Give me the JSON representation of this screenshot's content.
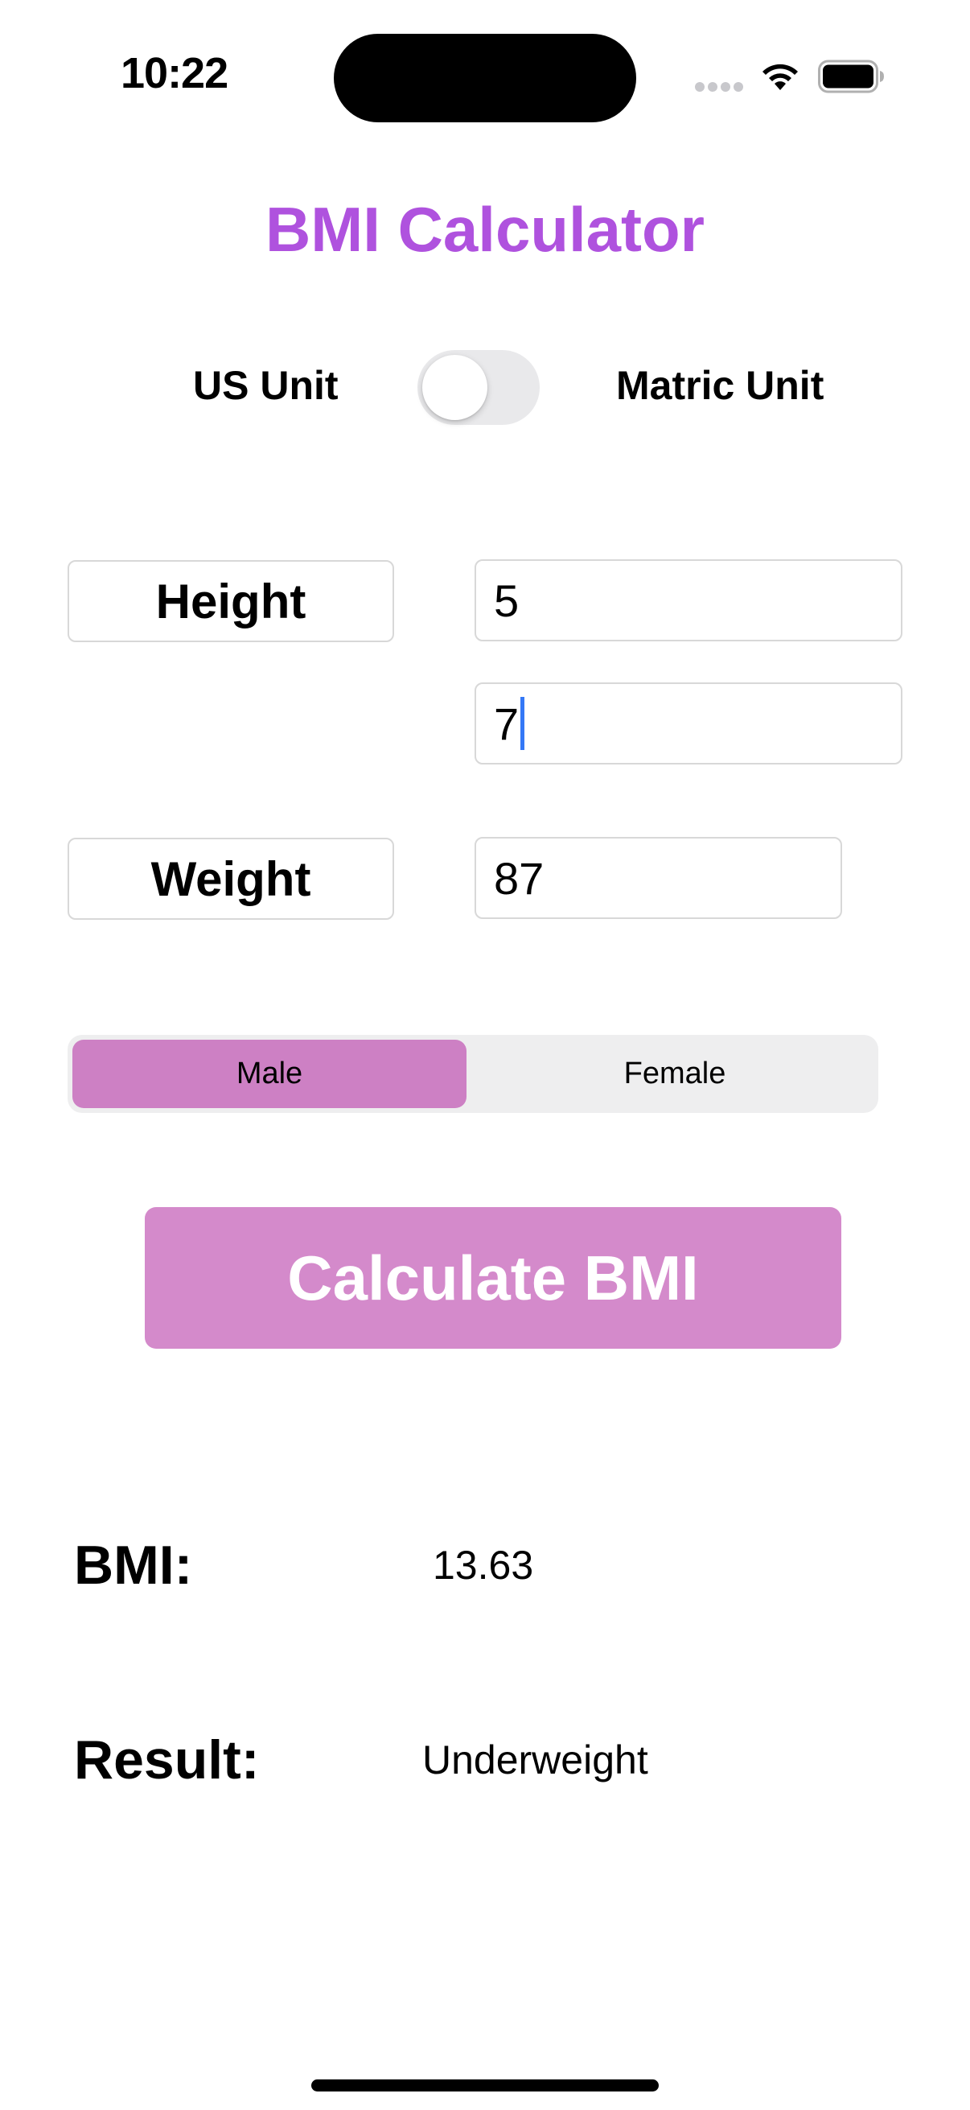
{
  "status_bar": {
    "time": "10:22"
  },
  "app": {
    "title": "BMI Calculator",
    "title_color": "#af52de",
    "accent_color": "#d48acb"
  },
  "unit_toggle": {
    "left_label": "US Unit",
    "right_label": "Matric Unit",
    "is_on": false
  },
  "fields": {
    "height_label": "Height",
    "height_feet_value": "5",
    "height_inches_value": "7",
    "weight_label": "Weight",
    "weight_value": "87"
  },
  "gender": {
    "options": [
      "Male",
      "Female"
    ],
    "selected": "Male"
  },
  "calculate_button": {
    "label": "Calculate BMI"
  },
  "results": {
    "bmi_label": "BMI:",
    "bmi_value": "13.63",
    "result_label": "Result:",
    "result_value": "Underweight"
  },
  "icons": {
    "status": [
      "signal-icon",
      "wifi-icon",
      "battery-icon"
    ]
  }
}
